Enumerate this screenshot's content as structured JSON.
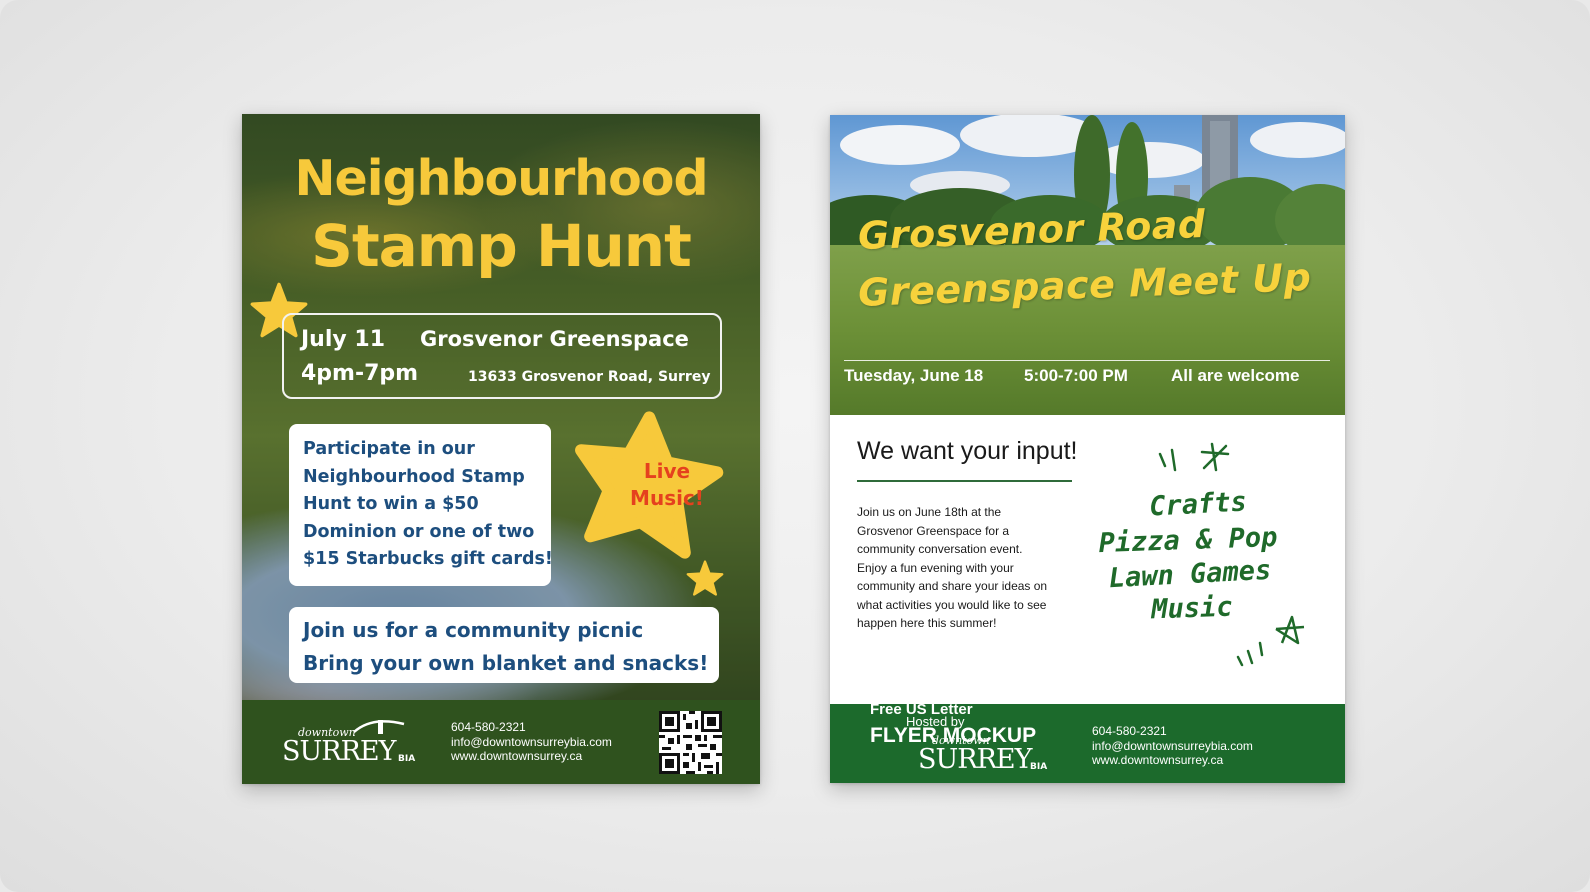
{
  "left_flyer": {
    "title_line1": "Neighbourhood",
    "title_line2": "Stamp Hunt",
    "date": "July 11",
    "time": "4pm-7pm",
    "venue": "Grosvenor Greenspace",
    "address": "13633 Grosvenor Road, Surrey",
    "prize_lines": [
      "Participate in our",
      "Neighbourhood Stamp",
      "Hunt to win a $50",
      "Dominion or one of two",
      "$15 Starbucks gift cards!"
    ],
    "live_music_line1": "Live",
    "live_music_line2": "Music!",
    "picnic_line1": "Join us for a community picnic",
    "picnic_line2": "Bring your own blanket and snacks!",
    "logo_small": "downtown",
    "logo_big": "SURREY",
    "logo_suffix": "BIA",
    "phone": "604-580-2321",
    "email": "info@downtownsurreybia.com",
    "website": "www.downtownsurrey.ca"
  },
  "right_flyer": {
    "title_line1": "Grosvenor Road",
    "title_line2": "Greenspace Meet Up",
    "date": "Tuesday, June 18",
    "time": "5:00-7:00 PM",
    "welcome": "All are welcome",
    "heading": "We want your input!",
    "body_lines": [
      "Join us on June 18th at the",
      "Grosvenor Greenspace for a",
      "community conversation event.",
      "Enjoy a fun evening with your",
      "community and share your ideas on",
      "what activities you would like to see",
      "happen here this summer!"
    ],
    "activities": [
      "Crafts",
      "Pizza & Pop",
      "Lawn Games",
      "Music"
    ],
    "watermark_line1": "Free US Letter",
    "watermark_line2": "Hosted by",
    "watermark_line3": "FLYER MOCKUP",
    "logo_small": "downtown",
    "logo_big": "SURREY",
    "logo_suffix": "BIA",
    "phone": "604-580-2321",
    "email": "info@downtownsurreybia.com",
    "website": "www.downtownsurrey.ca"
  },
  "colors": {
    "title_yellow": "#f7c93b",
    "star_yellow": "#f7c93b",
    "box_text_blue": "#1d4e7e",
    "live_music_red": "#e5411e",
    "left_footer_green": "#2f521e",
    "right_footer_green": "#1c6a2c",
    "handwriting_green": "#1f6a2a"
  }
}
